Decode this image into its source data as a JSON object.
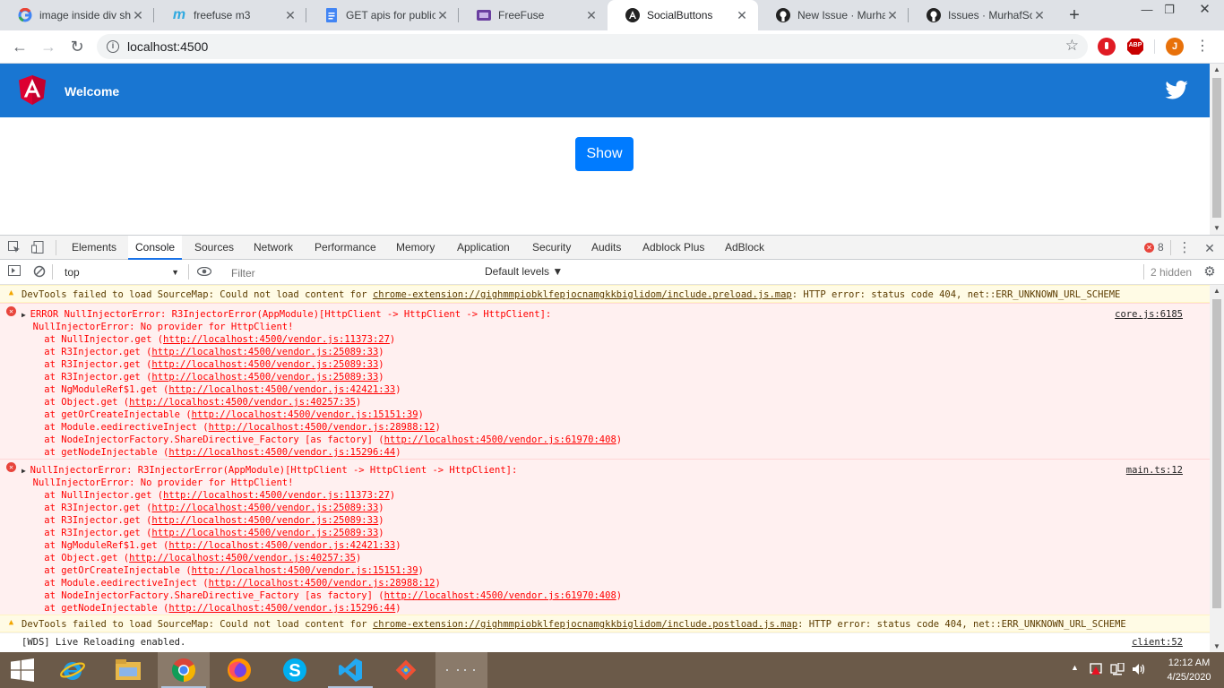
{
  "browser": {
    "tabs": [
      {
        "title": "image inside div sh",
        "icon": "google-icon"
      },
      {
        "title": "freefuse m3",
        "icon": "m-icon"
      },
      {
        "title": "GET apis for public",
        "icon": "docs-icon"
      },
      {
        "title": "FreeFuse",
        "icon": "freefuse-icon"
      },
      {
        "title": "SocialButtons",
        "icon": "angular-icon"
      },
      {
        "title": "New Issue · Murhaf",
        "icon": "github-icon"
      },
      {
        "title": "Issues · MurhafSou",
        "icon": "github-icon"
      }
    ],
    "active_tab_index": 4,
    "url": "localhost:4500",
    "profile_initial": "J",
    "abp_label": "ABP"
  },
  "page": {
    "brand_title": "Welcome",
    "show_button": "Show",
    "navbar_color": "#1976d2",
    "button_color": "#007bff"
  },
  "devtools": {
    "tabs": [
      "Elements",
      "Console",
      "Sources",
      "Network",
      "Performance",
      "Memory",
      "Application",
      "Security",
      "Audits",
      "Adblock Plus",
      "AdBlock"
    ],
    "active_tab": "Console",
    "error_count": "8",
    "context": "top",
    "filter_placeholder": "Filter",
    "levels": "Default levels ▼",
    "hidden": "2 hidden",
    "messages": [
      {
        "level": "warning",
        "lines": [
          "DevTools failed to load SourceMap: Could not load content for ",
          "chrome-extension://gighmmpiobklfepjocnamgkkbiglidom/include.preload.js.map",
          ": HTTP error: status code 404, net::ERR_UNKNOWN_URL_SCHEME"
        ]
      },
      {
        "level": "error",
        "source": "core.js:6185",
        "lines": [
          "ERROR NullInjectorError: R3InjectorError(AppModule)[HttpClient -> HttpClient -> HttpClient]:",
          "  NullInjectorError: No provider for HttpClient!",
          "    at NullInjector.get (http://localhost:4500/vendor.js:11373:27)",
          "    at R3Injector.get (http://localhost:4500/vendor.js:25089:33)",
          "    at R3Injector.get (http://localhost:4500/vendor.js:25089:33)",
          "    at R3Injector.get (http://localhost:4500/vendor.js:25089:33)",
          "    at NgModuleRef$1.get (http://localhost:4500/vendor.js:42421:33)",
          "    at Object.get (http://localhost:4500/vendor.js:40257:35)",
          "    at getOrCreateInjectable (http://localhost:4500/vendor.js:15151:39)",
          "    at Module.eedirectiveInject (http://localhost:4500/vendor.js:28988:12)",
          "    at NodeInjectorFactory.ShareDirective_Factory [as factory] (http://localhost:4500/vendor.js:61970:408)",
          "    at getNodeInjectable (http://localhost:4500/vendor.js:15296:44)"
        ]
      },
      {
        "level": "error",
        "source": "main.ts:12",
        "lines": [
          "NullInjectorError: R3InjectorError(AppModule)[HttpClient -> HttpClient -> HttpClient]:",
          "  NullInjectorError: No provider for HttpClient!",
          "    at NullInjector.get (http://localhost:4500/vendor.js:11373:27)",
          "    at R3Injector.get (http://localhost:4500/vendor.js:25089:33)",
          "    at R3Injector.get (http://localhost:4500/vendor.js:25089:33)",
          "    at R3Injector.get (http://localhost:4500/vendor.js:25089:33)",
          "    at NgModuleRef$1.get (http://localhost:4500/vendor.js:42421:33)",
          "    at Object.get (http://localhost:4500/vendor.js:40257:35)",
          "    at getOrCreateInjectable (http://localhost:4500/vendor.js:15151:39)",
          "    at Module.eedirectiveInject (http://localhost:4500/vendor.js:28988:12)",
          "    at NodeInjectorFactory.ShareDirective_Factory [as factory] (http://localhost:4500/vendor.js:61970:408)",
          "    at getNodeInjectable (http://localhost:4500/vendor.js:15296:44)"
        ]
      },
      {
        "level": "warning",
        "lines": [
          "DevTools failed to load SourceMap: Could not load content for ",
          "chrome-extension://gighmmpiobklfepjocnamgkkbiglidom/include.postload.js.map",
          ": HTTP error: status code 404, net::ERR_UNKNOWN_URL_SCHEME"
        ]
      },
      {
        "level": "log",
        "source": "client:52",
        "lines": [
          "[WDS] Live Reloading enabled."
        ]
      }
    ]
  },
  "taskbar": {
    "time": "12:12 AM",
    "date": "4/25/2020"
  }
}
